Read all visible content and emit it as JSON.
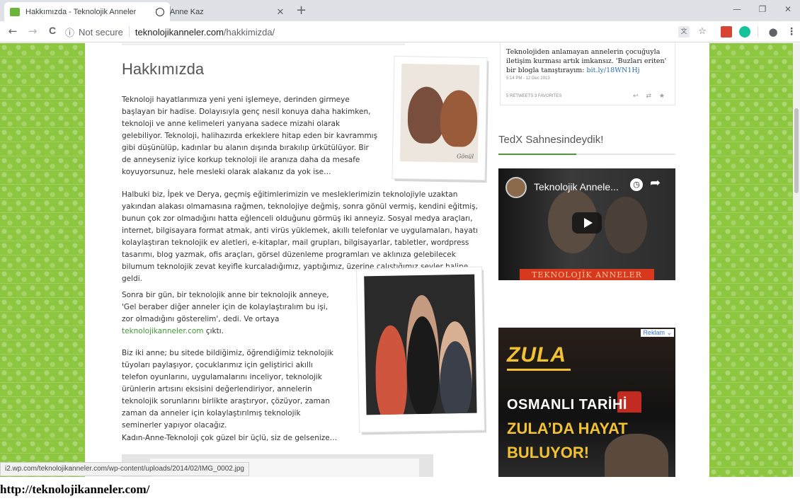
{
  "browser": {
    "tabs": [
      {
        "title": "Hakkımızda - Teknolojik Anneler",
        "active": true,
        "favicon_color": "#6bb53a"
      },
      {
        "title": "Anne Kaz",
        "active": false
      }
    ],
    "new_tab_label": "+",
    "window_controls": {
      "minimize": "—",
      "maximize": "❐",
      "close": "✕"
    },
    "nav": {
      "back": "←",
      "forward": "→",
      "reload": "C"
    },
    "address": {
      "security_icon": "info-icon",
      "security_label": "Not secure",
      "domain": "teknolojikanneler.com",
      "path": "/hakkimizda/"
    },
    "toolbar_icons": [
      "translate-icon",
      "star-icon",
      "pdf-extension-icon",
      "grammarly-icon",
      "profile-icon",
      "menu-icon"
    ]
  },
  "page": {
    "title": "Hakkımızda",
    "paragraphs": {
      "p1": "Teknoloji hayatlarımıza yeni yeni işlemeye, derinden girmeye başlayan bir hadise. Dolayısıyla genç nesil konuya daha hakimken, teknoloji ve anne kelimeleri yanyana sadece mizahi olarak gelebiliyor. Teknoloji, halihazırda erkeklere hitap eden bir kavrammış gibi düşünülüp, kadınlar bu alanın dışında bırakılıp ürkütülüyor. Bir de anneyseniz iyice korkup teknoloji ile aranıza daha da mesafe koyuyorsunuz, hele mesleki olarak alakanız da yok ise…",
      "p2": "Halbuki biz, İpek ve Derya, geçmiş eğitimlerimizin ve mesleklerimizin teknolojiyle uzaktan yakından alakası olmamasına rağmen, teknolojiye değmiş, sonra gönül vermiş, kendini eğitmiş, bunun çok zor olmadığını hatta eğlenceli olduğunu görmüş iki anneyiz. Sosyal medya araçları, internet, bilgisayara format atmak, anti virüs yüklemek, akıllı telefonlar ve uygulamaları, hayatı kolaylaştıran teknolojik ev aletleri, e-kitaplar, mail grupları, bilgisayarlar, tabletler, wordpress tasarımı, blog yazmak, ofis araçları, görsel düzenleme programları ve aklınıza gelebilecek bilumum teknolojik zevat keyifle kurcaladığımız, yaptığımız, üzerine çalıştığımız şeyler haline geldi.",
      "p3_before": "Sonra bir gün, bir teknolojik anne bir teknolojik anneye, 'Gel beraber diğer anneler için de kolaylaştıralım bu işi, zor olmadığını gösterelim', dedi. Ve ortaya ",
      "p3_link": "teknolojikanneler.com",
      "p3_after": " çıktı.",
      "p4": "Biz iki anne; bu sitede bildiğimiz, öğrendiğimiz teknolojik tüyoları paylaşıyor, çocuklarımız için geliştirici akıllı telefon oyunlarını, uygulamalarını inceliyor, teknolojik ürünlerin artısını eksisini değerlendiriyor, annelerin teknolojik sorunlarını birlikte araştıryor, çözüyor, zaman zaman da anneler için kolaylaştırılmış teknolojik seminerler yapıyor olacağız.",
      "p5": "Kadın-Anne-Teknoloji çok güzel bir üçlü, siz de gelsenize…"
    },
    "photo1_signature": "Gönül",
    "status_url": "i2.wp.com/teknolojikanneler.com/wp-content/uploads/2014/02/IMG_0002.jpg"
  },
  "sidebar": {
    "tweet": {
      "text": "Teknolojiden anlamayan annelerin çocuğuyla iletişim kurması artık imkansız. 'Buzları eriten' bir blogla tanıştırayım:",
      "link": "bit.ly/18WN1Hj",
      "time": "5:14 PM - 12 Dec 2013",
      "stats": "5 RETWEETS  3 FAVORITES",
      "actions": "↩ ⇄ ★"
    },
    "widget_title": "TedX Sahnesindeydik!",
    "video": {
      "title": "Teknolojik Annele...",
      "banner": "TEKNOLOJİK ANNELER"
    },
    "ad": {
      "badge": "Reklam ⌄",
      "brand": "ZULA",
      "line1": "OSMANLI TARİHİ",
      "line2": "ZULA’DA HAYAT",
      "line3": "BULUYOR!"
    }
  },
  "caption": "http://teknolojikanneler.com/",
  "colors": {
    "background_green": "#8dc63f",
    "link_green": "#3b9c2f",
    "widget_accent": "#4a9d2f",
    "ad_yellow": "#f3c233"
  }
}
